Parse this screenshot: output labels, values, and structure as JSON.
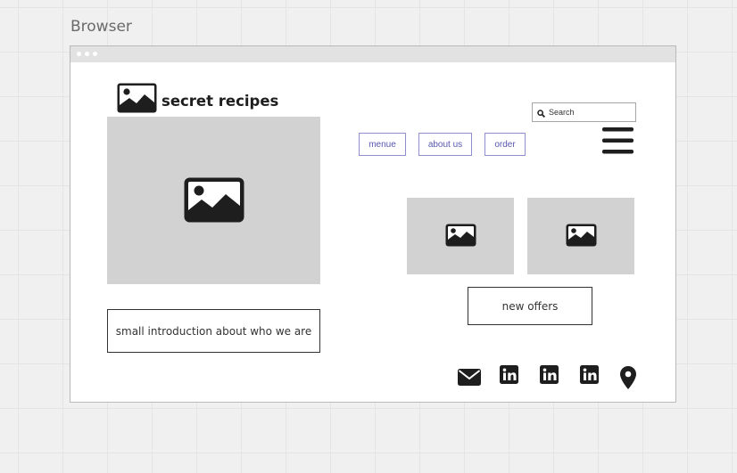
{
  "frame": {
    "label": "Browser"
  },
  "site": {
    "title": "secret recipes",
    "intro": "small introduction about who we are"
  },
  "search": {
    "placeholder": "Search"
  },
  "nav": {
    "menu": "menue",
    "about": "about us",
    "order": "order"
  },
  "offers": {
    "label": "new offers"
  },
  "icons": {
    "logo": "image-icon",
    "hero": "image-placeholder-icon",
    "hamburger": "hamburger-menu-icon",
    "social": [
      "mail-icon",
      "linkedin-icon",
      "linkedin-icon",
      "linkedin-icon",
      "map-pin-icon"
    ]
  },
  "colors": {
    "placeholder_fill": "#d2d2d2",
    "nav_link": "#5757b0",
    "nav_border": "#8f8fcf",
    "icon": "#1e1e1e"
  }
}
